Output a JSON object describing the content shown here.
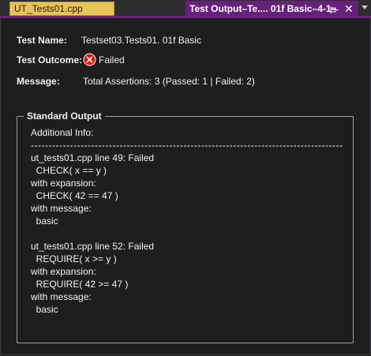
{
  "tabs": {
    "inactive_label": "UT_Tests01.cpp",
    "active_label": "Test Output–Te.... 01f Basic–4-1",
    "close_glyph": "✕"
  },
  "details": {
    "test_name_label": "Test Name:",
    "test_name_value": "Testset03.Tests01. 01f Basic",
    "outcome_label": "Test Outcome:",
    "outcome_value": "Failed",
    "message_label": "Message:",
    "message_value": "Total Assertions: 3 (Passed: 1 | Failed: 2)"
  },
  "standard_output": {
    "title": "Standard Output",
    "lines": [
      "Additional Info:",
      "----------------------------------------------------------------------------------------",
      "ut_tests01.cpp line 49: Failed",
      "  CHECK( x == y )",
      "with expansion:",
      "  CHECK( 42 == 47 )",
      "with message:",
      "  basic",
      "",
      "ut_tests01.cpp line 52: Failed",
      "  REQUIRE( x >= y )",
      "with expansion:",
      "  REQUIRE( 42 >= 47 )",
      "with message:",
      "  basic",
      "",
      "",
      "----------------------------------------------------------------------------------------"
    ]
  },
  "colors": {
    "accent": "#68217a",
    "inactive_tab": "#e8c35a",
    "fail": "#e51400",
    "background": "#1e1e1e"
  },
  "icons": {
    "pin": "pin-icon",
    "close": "close-icon",
    "dropdown": "chevron-down-icon",
    "outcome": "failed-icon"
  }
}
